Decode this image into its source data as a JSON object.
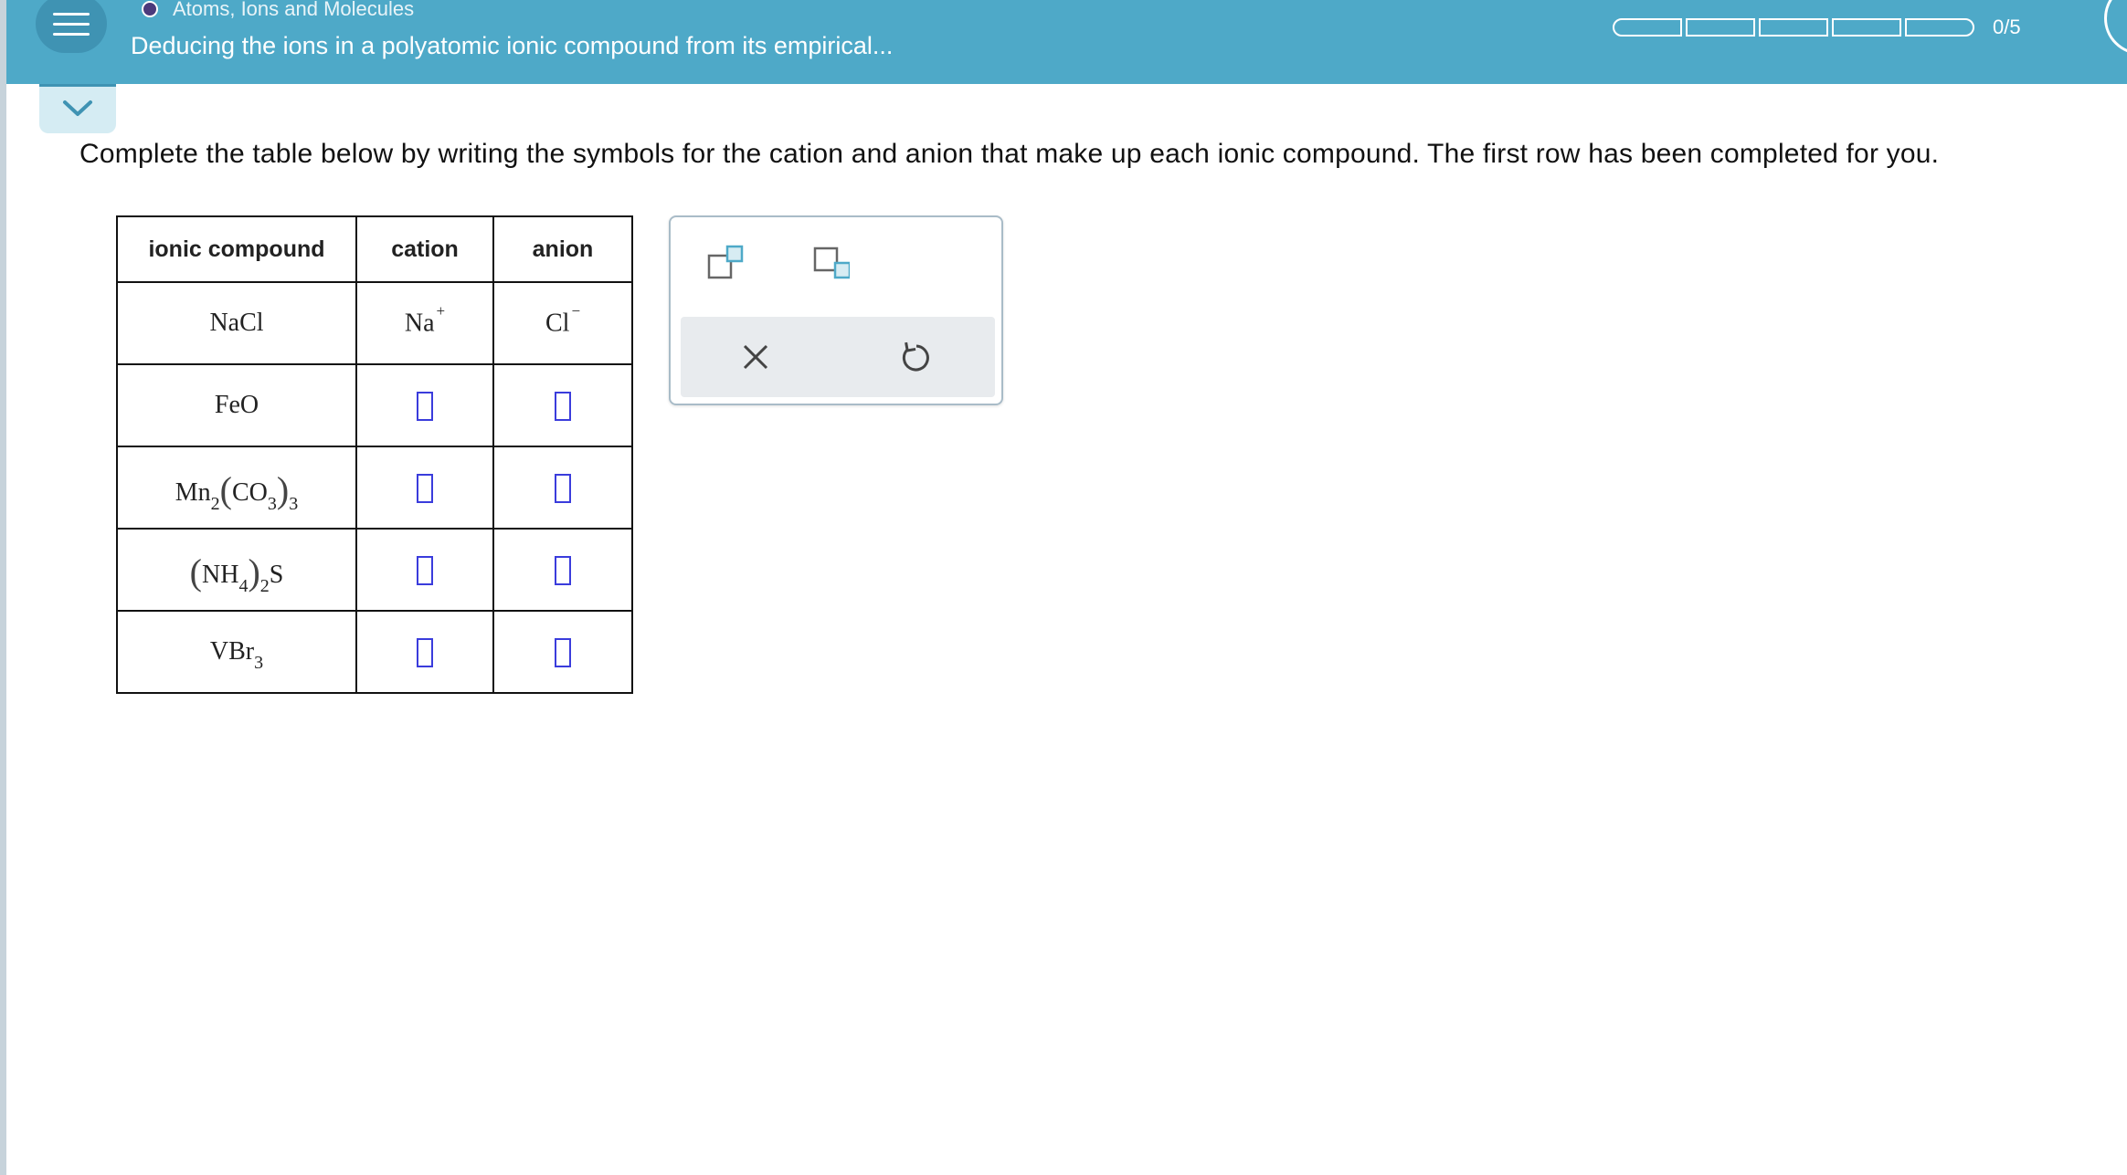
{
  "header": {
    "topic": "Atoms, Ions and Molecules",
    "title": "Deducing the ions in a polyatomic ionic compound from its empirical...",
    "progress_label": "0/5",
    "progress_fraction": 0,
    "progress_segments": 5
  },
  "instructions": "Complete the table below by writing the symbols for the cation and anion that make up each ionic compound. The first row has been completed for you.",
  "table": {
    "headers": [
      "ionic compound",
      "cation",
      "anion"
    ],
    "row1": {
      "compound": "NaCl",
      "cation": "Na",
      "cation_charge": "+",
      "anion": "Cl",
      "anion_charge": "−"
    },
    "row2": {
      "compound": "FeO"
    },
    "row3": {
      "compound_a": "Mn",
      "compound_a_sub": "2",
      "compound_b": "CO",
      "compound_b_sub": "3",
      "compound_c_sub": "3"
    },
    "row4": {
      "compound_a": "NH",
      "compound_a_sub": "4",
      "compound_b_sub": "2",
      "compound_c": "S"
    },
    "row5": {
      "compound_a": "VBr",
      "compound_a_sub": "3"
    }
  },
  "tools": {
    "superscript_icon": "superscript-box-icon",
    "subscript_icon": "subscript-box-icon",
    "clear_icon": "x-icon",
    "undo_icon": "undo-icon"
  },
  "colors": {
    "header_bg": "#4ea9c8",
    "answer_box": "#3a3cdc",
    "tool_accent": "#4ea9c8"
  }
}
